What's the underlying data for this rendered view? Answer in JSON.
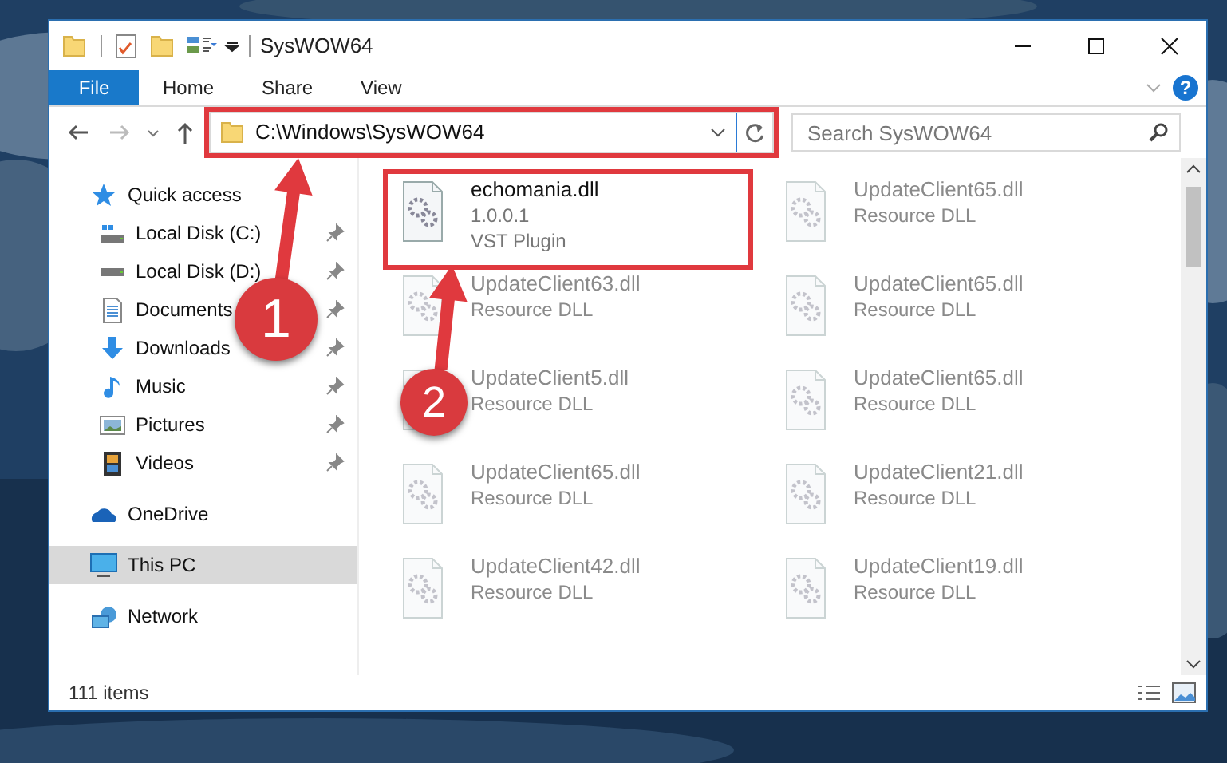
{
  "window": {
    "title": "SysWOW64"
  },
  "ribbon": {
    "tabs": [
      {
        "label": "File",
        "selected": true
      },
      {
        "label": "Home",
        "selected": false
      },
      {
        "label": "Share",
        "selected": false
      },
      {
        "label": "View",
        "selected": false
      }
    ],
    "help": "?"
  },
  "address": {
    "path": "C:\\Windows\\SysWOW64",
    "highlighted": true
  },
  "search": {
    "placeholder": "Search SysWOW64"
  },
  "nav": [
    {
      "label": "Quick access",
      "kind": "star",
      "selected": false,
      "children": [
        {
          "label": "Local Disk (C:)",
          "kind": "drive-c",
          "pinned": true
        },
        {
          "label": "Local Disk (D:)",
          "kind": "drive",
          "pinned": true
        },
        {
          "label": "Documents",
          "kind": "documents",
          "pinned": true
        },
        {
          "label": "Downloads",
          "kind": "downloads",
          "pinned": true
        },
        {
          "label": "Music",
          "kind": "music",
          "pinned": true
        },
        {
          "label": "Pictures",
          "kind": "pictures",
          "pinned": true
        },
        {
          "label": "Videos",
          "kind": "videos",
          "pinned": true
        }
      ]
    },
    {
      "label": "OneDrive",
      "kind": "cloud",
      "selected": false
    },
    {
      "label": "This PC",
      "kind": "pc",
      "selected": true
    },
    {
      "label": "Network",
      "kind": "network",
      "selected": false
    }
  ],
  "files": [
    {
      "name": "echomania.dll",
      "details": [
        "1.0.0.1",
        "VST Plugin"
      ],
      "highlighted": true,
      "blurred": false
    },
    {
      "name": "UpdateClient65.dll",
      "details": [
        "Resource DLL"
      ],
      "highlighted": false,
      "blurred": true
    },
    {
      "name": "UpdateClient63.dll",
      "details": [
        "Resource DLL"
      ],
      "highlighted": false,
      "blurred": true
    },
    {
      "name": "UpdateClient65.dll",
      "details": [
        "Resource DLL"
      ],
      "highlighted": false,
      "blurred": true
    },
    {
      "name": "UpdateClient5.dll",
      "details": [
        "Resource DLL"
      ],
      "highlighted": false,
      "blurred": true
    },
    {
      "name": "UpdateClient65.dll",
      "details": [
        "Resource DLL"
      ],
      "highlighted": false,
      "blurred": true
    },
    {
      "name": "UpdateClient65.dll",
      "details": [
        "Resource DLL"
      ],
      "highlighted": false,
      "blurred": true
    },
    {
      "name": "UpdateClient21.dll",
      "details": [
        "Resource DLL"
      ],
      "highlighted": false,
      "blurred": true
    },
    {
      "name": "UpdateClient42.dll",
      "details": [
        "Resource DLL"
      ],
      "highlighted": false,
      "blurred": true
    },
    {
      "name": "UpdateClient19.dll",
      "details": [
        "Resource DLL"
      ],
      "highlighted": false,
      "blurred": true
    }
  ],
  "status_bar": {
    "count": "111 items"
  },
  "callouts": [
    {
      "number": "1"
    },
    {
      "number": "2"
    }
  ]
}
